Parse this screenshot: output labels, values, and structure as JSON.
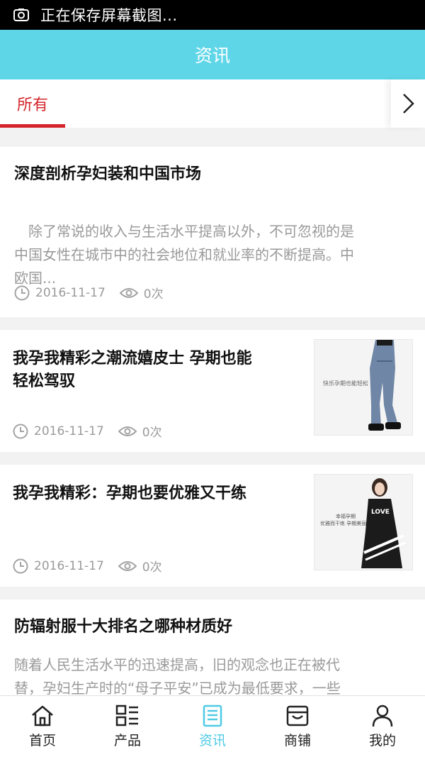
{
  "status_bar": {
    "text": "正在保存屏幕截图..."
  },
  "header": {
    "title": "资讯"
  },
  "tabs": {
    "all_label": "所有"
  },
  "articles": [
    {
      "title": "深度剖析孕妇装和中国市场",
      "summary_line1": "　除了常说的收入与生活水平提高以外，不可忽视的是",
      "summary_line2": "中国女性在城市中的社会地位和就业率的不断提高。中",
      "summary_line3": "欧国...",
      "date": "2016-11-17",
      "views": "0次"
    },
    {
      "title_line1": "我孕我精彩之潮流嬉皮士 孕期也能",
      "title_line2": "轻松驾驭",
      "thumb_caption": "快乐孕期也能轻松",
      "date": "2016-11-17",
      "views": "0次"
    },
    {
      "title": "我孕我精彩：孕期也要优雅又干练",
      "thumb_caption_line1": "幸福孕期",
      "thumb_caption_line2": "优雅而干练 孕期美丽",
      "thumb_shirt_text": "LOVE",
      "date": "2016-11-17",
      "views": "0次"
    },
    {
      "title": "防辐射服十大排名之哪种材质好",
      "summary_line1": "随着人民生活水平的迅速提高，旧的观念也正在被代",
      "summary_line2": "替，孕妇生产时的“母子平安”已成为最低要求，一些"
    }
  ],
  "bottom_nav": [
    {
      "label": "首页",
      "icon": "home-icon"
    },
    {
      "label": "产品",
      "icon": "product-grid-icon"
    },
    {
      "label": "资讯",
      "icon": "news-icon",
      "active": true
    },
    {
      "label": "商铺",
      "icon": "shop-icon"
    },
    {
      "label": "我的",
      "icon": "user-icon"
    }
  ],
  "colors": {
    "header_bg": "#5ed6e8",
    "accent_red": "#d4252b",
    "active_nav": "#4fcbe4",
    "muted_text": "#9a9a9a"
  }
}
